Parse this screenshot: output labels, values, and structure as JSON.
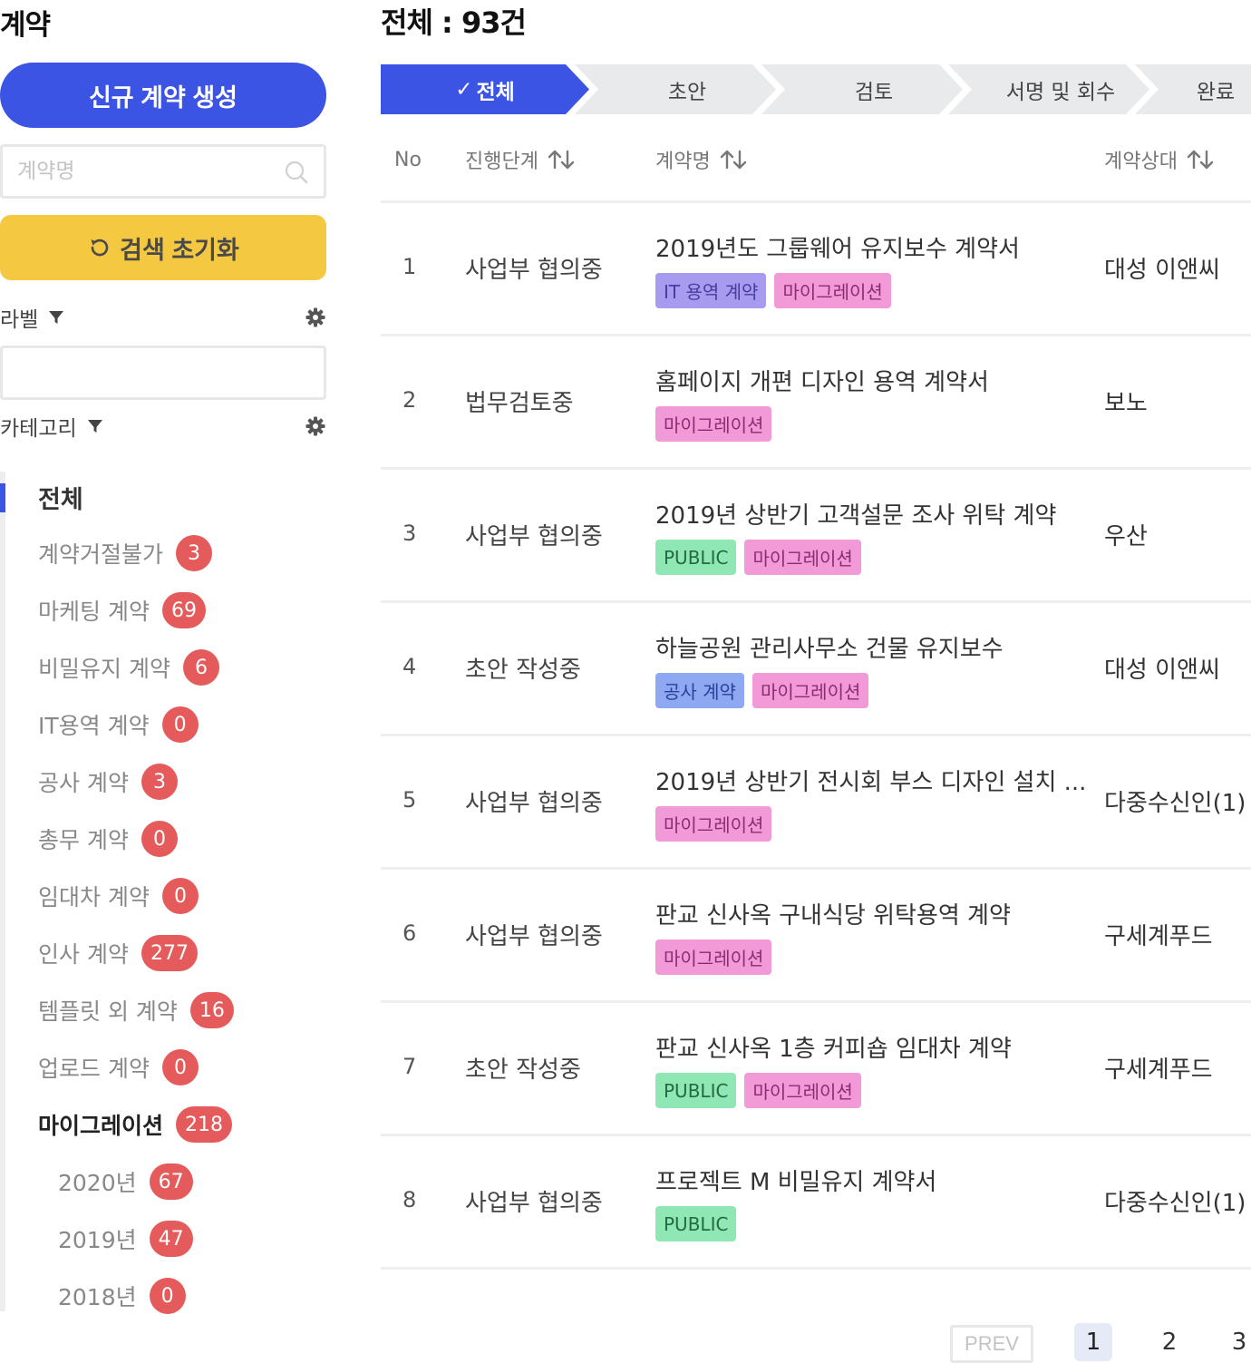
{
  "sidebar": {
    "title": "계약",
    "new_contract_label": "신규 계약 생성",
    "search_placeholder": "계약명",
    "reset_label": "검색 초기화",
    "label_filter": "라벨",
    "category_filter": "카테고리",
    "categories": [
      {
        "name": "전체",
        "count": null
      },
      {
        "name": "계약거절불가",
        "count": "3"
      },
      {
        "name": "마케팅 계약",
        "count": "69"
      },
      {
        "name": "비밀유지 계약",
        "count": "6"
      },
      {
        "name": "IT용역 계약",
        "count": "0"
      },
      {
        "name": "공사 계약",
        "count": "3"
      },
      {
        "name": "총무 계약",
        "count": "0"
      },
      {
        "name": "임대차 계약",
        "count": "0"
      },
      {
        "name": "인사 계약",
        "count": "277"
      },
      {
        "name": "템플릿 외 계약",
        "count": "16"
      },
      {
        "name": "업로드 계약",
        "count": "0"
      },
      {
        "name": "마이그레이션",
        "count": "218"
      },
      {
        "name": "2020년",
        "count": "67"
      },
      {
        "name": "2019년",
        "count": "47"
      },
      {
        "name": "2018년",
        "count": "0"
      }
    ]
  },
  "main": {
    "title": "전체 : 93건",
    "stages": [
      {
        "label": "전체",
        "check": "✓",
        "active": true
      },
      {
        "label": "초안",
        "active": false
      },
      {
        "label": "검토",
        "active": false
      },
      {
        "label": "서명 및 회수",
        "active": false
      },
      {
        "label": "완료",
        "active": false
      }
    ],
    "columns": {
      "no": "No",
      "stage": "진행단계",
      "name": "계약명",
      "party": "계약상대"
    },
    "rows": [
      {
        "no": "1",
        "stage": "사업부 협의중",
        "title": "2019년도 그룹웨어 유지보수 계약서",
        "tags": [
          {
            "text": "IT 용역 계약",
            "color": "purple"
          },
          {
            "text": "마이그레이션",
            "color": "pink"
          }
        ],
        "party": "대성 이앤씨"
      },
      {
        "no": "2",
        "stage": "법무검토중",
        "title": "홈페이지 개편 디자인 용역 계약서",
        "tags": [
          {
            "text": "마이그레이션",
            "color": "pink"
          }
        ],
        "party": "보노"
      },
      {
        "no": "3",
        "stage": "사업부 협의중",
        "title": "2019년 상반기 고객설문 조사 위탁 계약",
        "tags": [
          {
            "text": "PUBLIC",
            "color": "green"
          },
          {
            "text": "마이그레이션",
            "color": "pink"
          }
        ],
        "party": "우산"
      },
      {
        "no": "4",
        "stage": "초안 작성중",
        "title": "하늘공원 관리사무소 건물 유지보수",
        "tags": [
          {
            "text": "공사 계약",
            "color": "blue"
          },
          {
            "text": "마이그레이션",
            "color": "pink"
          }
        ],
        "party": "대성 이앤씨"
      },
      {
        "no": "5",
        "stage": "사업부 협의중",
        "title": "2019년 상반기 전시회 부스 디자인 설치 ...",
        "tags": [
          {
            "text": "마이그레이션",
            "color": "pink"
          }
        ],
        "party": "다중수신인(1)"
      },
      {
        "no": "6",
        "stage": "사업부 협의중",
        "title": "판교 신사옥 구내식당 위탁용역 계약",
        "tags": [
          {
            "text": "마이그레이션",
            "color": "pink"
          }
        ],
        "party": "구세계푸드"
      },
      {
        "no": "7",
        "stage": "초안 작성중",
        "title": "판교 신사옥 1층 커피숍 임대차 계약",
        "tags": [
          {
            "text": "PUBLIC",
            "color": "green"
          },
          {
            "text": "마이그레이션",
            "color": "pink"
          }
        ],
        "party": "구세계푸드"
      },
      {
        "no": "8",
        "stage": "사업부 협의중",
        "title": "프로젝트 M 비밀유지 계약서",
        "tags": [
          {
            "text": "PUBLIC",
            "color": "green"
          }
        ],
        "party": "다중수신인(1)"
      }
    ],
    "pagination": {
      "prev": "PREV",
      "pages": [
        "1",
        "2",
        "3"
      ],
      "current": "1"
    }
  },
  "colors": {
    "accent_blue": "#3b54e3",
    "reset_yellow": "#f5c842",
    "badge_red": "#e55b5b",
    "tag_purple": "#a79bf0",
    "tag_pink": "#f29ad8",
    "tag_green": "#8fe8b3",
    "tag_blue": "#8fa8f2"
  },
  "icons": [
    "search-icon",
    "refresh-icon",
    "funnel-icon",
    "gear-icon",
    "sort-icon",
    "check-icon"
  ]
}
